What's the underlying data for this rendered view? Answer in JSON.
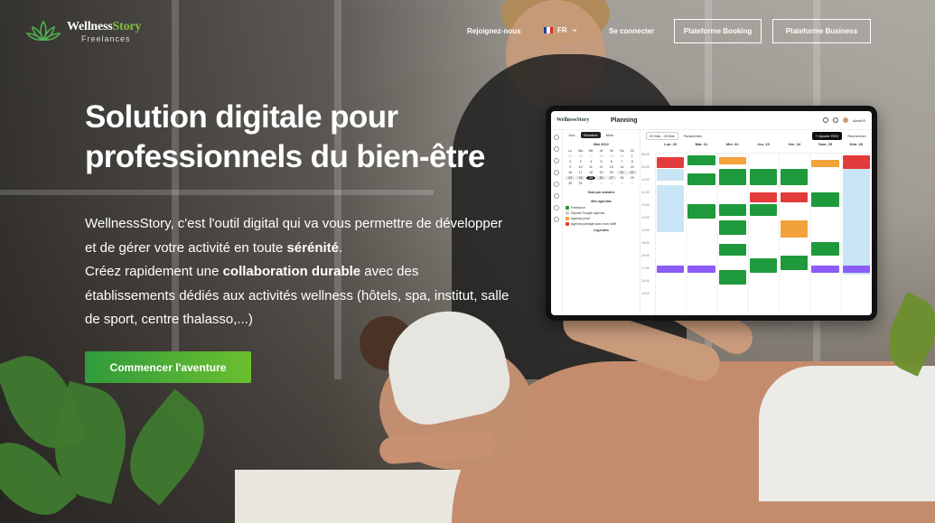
{
  "brand": {
    "name_part1": "Wellness",
    "name_part2": "Story",
    "subtitle": "Freelances"
  },
  "nav": {
    "join": "Rejoignez-nous",
    "language": "FR",
    "login": "Se connecter",
    "booking": "Plateforme Booking",
    "business": "Plateforme Business"
  },
  "hero": {
    "title_line1": "Solution digitale pour",
    "title_line2": "professionnels du bien-être",
    "p1_a": "WellnessStory, c'est l'outil digital qui va vous permettre de développer et de gérer votre activité en toute ",
    "p1_b": "sérénité",
    "p1_c": ".",
    "p2_a": "Créez rapidement une ",
    "p2_b": "collaboration durable",
    "p2_c": " avec des établissements dédiés aux activités wellness (hôtels, spa, institut, salle de sport, centre thalasso,...)",
    "cta": "Commencer l'aventure"
  },
  "mockup": {
    "logo": "WellnessStory",
    "title": "Planning",
    "user": "Alaria B.",
    "views": [
      "Jour",
      "Semaine",
      "Mois"
    ],
    "range": "20 Mai - 26 Mai",
    "params": "Paramètres",
    "add": "+ Ajouter RDV",
    "search": "Rechercher",
    "month": "Mai 2022",
    "weekdays": [
      "Lu",
      "Ma",
      "Me",
      "Je",
      "Ve",
      "Sa",
      "Di"
    ],
    "cal_days": [
      "25",
      "26",
      "27",
      "28",
      "29",
      "30",
      "1",
      "2",
      "3",
      "4",
      "5",
      "6",
      "7",
      "8",
      "9",
      "10",
      "11",
      "12",
      "13",
      "14",
      "15",
      "16",
      "17",
      "18",
      "19",
      "20",
      "21",
      "22",
      "23",
      "24",
      "25",
      "26",
      "27",
      "28",
      "29",
      "30",
      "31",
      "1",
      "2",
      "3",
      "4",
      "5"
    ],
    "days": [
      "Lun. 20",
      "Mar. 21",
      "Mer. 22",
      "Jeu. 23",
      "Ven. 24",
      "Sam. 25",
      "Dim. 26"
    ],
    "hours": [
      "08:00",
      "09:00",
      "10:00",
      "11:00",
      "12:00",
      "13:00",
      "14:00",
      "15:00",
      "16:00",
      "17:00",
      "18:00",
      "19:00"
    ],
    "goal": "Goal par semaine",
    "agendas_title": "Mes agendas",
    "agendas": [
      "Freelance",
      "Depuis Google Agenda",
      "Agenda privé",
      "Agenda partagé avec mon staff"
    ],
    "agenda_colors": [
      "#1e9a3c",
      "#cfcfcf",
      "#f2a23a",
      "#e23b3b"
    ],
    "footer": "Légendes"
  }
}
